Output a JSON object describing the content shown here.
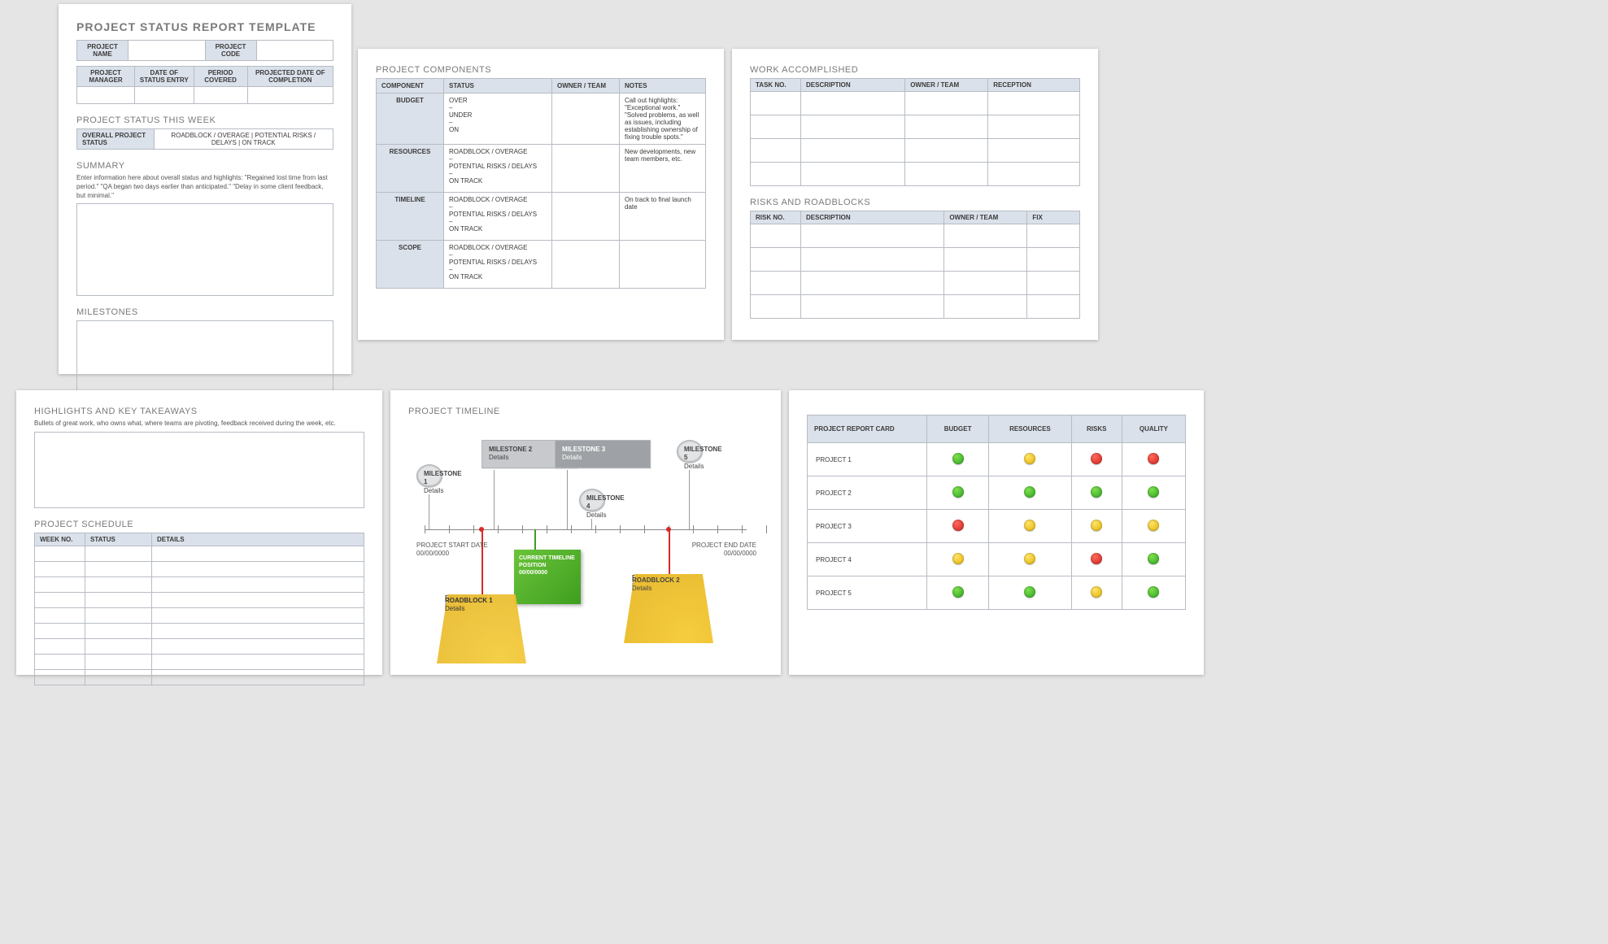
{
  "page1": {
    "title": "PROJECT STATUS REPORT TEMPLATE",
    "name_row": {
      "c1": "PROJECT NAME",
      "c2": "PROJECT CODE"
    },
    "info_row": [
      "PROJECT MANAGER",
      "DATE OF STATUS ENTRY",
      "PERIOD COVERED",
      "PROJECTED DATE OF COMPLETION"
    ],
    "status_week_h": "PROJECT STATUS THIS WEEK",
    "status_row": {
      "label": "OVERALL PROJECT STATUS",
      "opts": "ROADBLOCK / OVERAGE   |   POTENTIAL RISKS / DELAYS   |   ON TRACK"
    },
    "summary_h": "SUMMARY",
    "summary_hint": "Enter information here about overall status and highlights: \"Regained lost time from last period.\" \"QA began two days earlier than anticipated.\" \"Delay in some client feedback, but minimal.\"",
    "milestones_h": "MILESTONES"
  },
  "page2": {
    "title": "PROJECT COMPONENTS",
    "cols": [
      "COMPONENT",
      "STATUS",
      "OWNER / TEAM",
      "NOTES"
    ],
    "rows": [
      {
        "c": "BUDGET",
        "s": "OVER\n–\nUNDER\n–\nON",
        "n": "Call out highlights: \"Exceptional work.\" \"Solved problems, as well as issues, including establishing ownership of fixing trouble spots.\""
      },
      {
        "c": "RESOURCES",
        "s": "ROADBLOCK / OVERAGE\n–\nPOTENTIAL RISKS / DELAYS\n–\nON TRACK",
        "n": "New developments, new team members, etc."
      },
      {
        "c": "TIMELINE",
        "s": "ROADBLOCK / OVERAGE\n–\nPOTENTIAL RISKS / DELAYS\n–\nON TRACK",
        "n": "On track to final launch date"
      },
      {
        "c": "SCOPE",
        "s": "ROADBLOCK / OVERAGE\n–\nPOTENTIAL RISKS / DELAYS\n–\nON TRACK",
        "n": ""
      }
    ]
  },
  "page3": {
    "work_h": "WORK ACCOMPLISHED",
    "work_cols": [
      "TASK NO.",
      "DESCRIPTION",
      "OWNER / TEAM",
      "RECEPTION"
    ],
    "risks_h": "RISKS AND ROADBLOCKS",
    "risks_cols": [
      "RISK NO.",
      "DESCRIPTION",
      "OWNER / TEAM",
      "FIX"
    ]
  },
  "page4": {
    "title": "HIGHLIGHTS AND KEY TAKEAWAYS",
    "hint": "Bullets of great work, who owns what, where teams are pivoting, feedback received during the week, etc.",
    "sched_h": "PROJECT SCHEDULE",
    "sched_cols": [
      "WEEK NO.",
      "STATUS",
      "DETAILS"
    ]
  },
  "page5": {
    "title": "PROJECT TIMELINE",
    "ms": [
      {
        "h": "MILESTONE 1",
        "d": "Details"
      },
      {
        "h": "MILESTONE 2",
        "d": "Details"
      },
      {
        "h": "MILESTONE 3",
        "d": "Details"
      },
      {
        "h": "MILESTONE 4",
        "d": "Details"
      },
      {
        "h": "MILESTONE 5",
        "d": "Details"
      }
    ],
    "rb": [
      {
        "h": "ROADBLOCK 1",
        "d": "Details"
      },
      {
        "h": "ROADBLOCK 2",
        "d": "Details"
      }
    ],
    "start": {
      "a": "PROJECT START DATE",
      "b": "00/00/0000"
    },
    "end": {
      "a": "PROJECT END DATE",
      "b": "00/00/0000"
    },
    "current": "CURRENT TIMELINE POSITION 00/00/0000"
  },
  "page6": {
    "cols": [
      "PROJECT REPORT CARD",
      "BUDGET",
      "RESOURCES",
      "RISKS",
      "QUALITY"
    ],
    "rows": [
      {
        "p": "PROJECT 1",
        "v": [
          "g",
          "y",
          "r",
          "r"
        ]
      },
      {
        "p": "PROJECT 2",
        "v": [
          "g",
          "g",
          "g",
          "g"
        ]
      },
      {
        "p": "PROJECT 3",
        "v": [
          "r",
          "y",
          "y",
          "y"
        ]
      },
      {
        "p": "PROJECT 4",
        "v": [
          "y",
          "y",
          "r",
          "g"
        ]
      },
      {
        "p": "PROJECT 5",
        "v": [
          "g",
          "g",
          "y",
          "g"
        ]
      }
    ]
  }
}
